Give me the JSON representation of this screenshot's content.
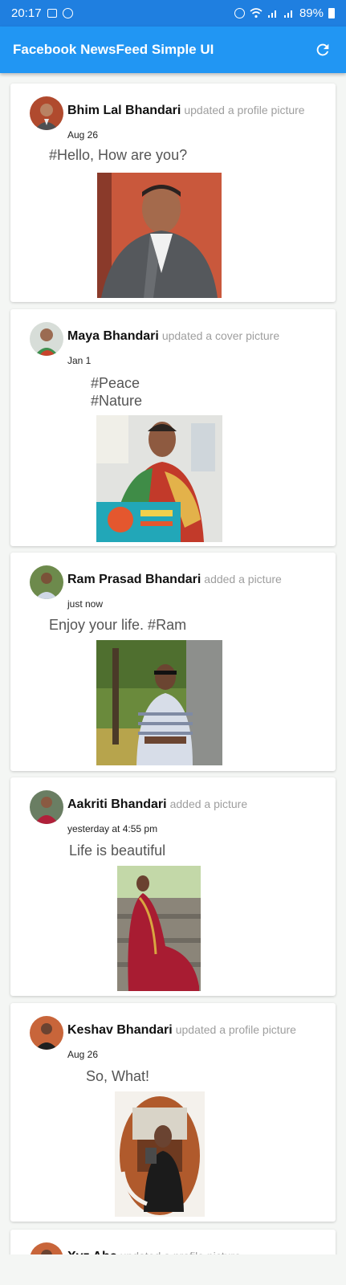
{
  "status_bar": {
    "time": "20:17",
    "battery": "89%",
    "icons": [
      "image-icon",
      "whatsapp-icon",
      "alarm-icon",
      "wifi-icon",
      "signal-icon",
      "signal-icon",
      "battery-icon"
    ]
  },
  "app_bar": {
    "title": "Facebook NewsFeed Simple UI",
    "refresh_icon": "refresh-icon",
    "color": "#2196f3"
  },
  "posts": [
    {
      "name": "Bhim Lal Bhandari",
      "action": "updated a profile picture",
      "time": "Aug 26",
      "caption": "#Hello, How are you?"
    },
    {
      "name": "Maya Bhandari",
      "action": "updated a cover picture",
      "time": "Jan 1",
      "caption": "#Peace\n#Nature"
    },
    {
      "name": "Ram Prasad Bhandari",
      "action": "added a picture",
      "time": "just now",
      "caption": "Enjoy your life. #Ram"
    },
    {
      "name": "Aakriti Bhandari",
      "action": "added a picture",
      "time": "yesterday at 4:55 pm",
      "caption": "Life is beautiful"
    },
    {
      "name": "Keshav Bhandari",
      "action": "updated a profile picture",
      "time": "Aug 26",
      "caption": "So, What!"
    },
    {
      "name": "Xyz Abc",
      "action": "updated a profile picture"
    }
  ]
}
